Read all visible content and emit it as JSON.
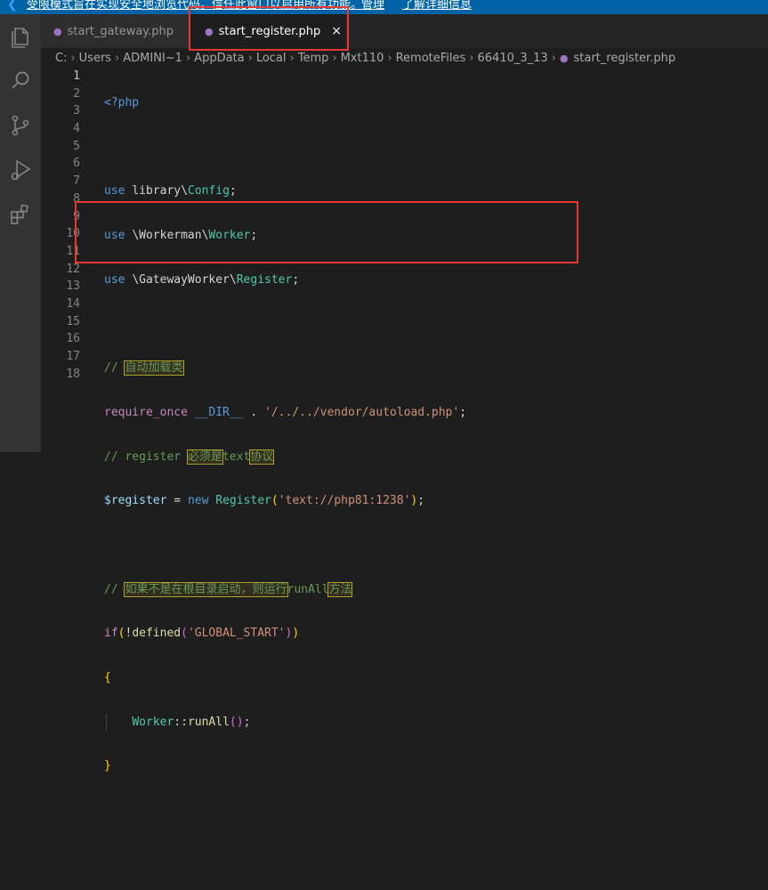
{
  "titlebar": {
    "notice": "受限模式旨在实现安全地浏览代码。信任此窗口以启用所有功能。",
    "action_manage": "管理",
    "action_learn": "了解详细信息"
  },
  "tabs": [
    {
      "label": "start_gateway.php",
      "active": false
    },
    {
      "label": "start_register.php",
      "active": true
    }
  ],
  "tab_close_glyph": "×",
  "breadcrumb": [
    "C:",
    "Users",
    "ADMINI~1",
    "AppData",
    "Local",
    "Temp",
    "Mxt110",
    "RemoteFiles",
    "66410_3_13",
    "start_register.php"
  ],
  "breadcrumb_sep": "›",
  "line_numbers": [
    "1",
    "2",
    "3",
    "4",
    "5",
    "6",
    "7",
    "8",
    "9",
    "10",
    "11",
    "12",
    "13",
    "14",
    "15",
    "16",
    "17",
    "18"
  ],
  "code": {
    "l1_tag": "<?php",
    "l3_use": "use",
    "l3_ns": "library",
    "l3_sep": "\\",
    "l3_cls": "Config",
    "l3_end": ";",
    "l4_use": "use",
    "l4_sep1": "\\",
    "l4_ns": "Workerman",
    "l4_sep2": "\\",
    "l4_cls": "Worker",
    "l4_end": ";",
    "l5_use": "use",
    "l5_sep1": "\\",
    "l5_ns": "GatewayWorker",
    "l5_sep2": "\\",
    "l5_cls": "Register",
    "l5_end": ";",
    "l7_slash": "// ",
    "l7_text": "自动加载类",
    "l8_kw": "require_once",
    "l8_sp": " ",
    "l8_const": "__DIR__",
    "l8_dot": " . ",
    "l8_str": "'/../../vendor/autoload.php'",
    "l8_end": ";",
    "l9_slash": "// register ",
    "l9_hl1": "必须是",
    "l9_mid": "text",
    "l9_hl2": "协议",
    "l10_var": "$register",
    "l10_eq": " = ",
    "l10_new": "new",
    "l10_sp": " ",
    "l10_cls": "Register",
    "l10_po": "(",
    "l10_str": "'text://php81:1238'",
    "l10_pc": ")",
    "l10_end": ";",
    "l12_slash": "// ",
    "l12_hl1": "如果不是在根目录启动，则运行",
    "l12_mid": "runAll",
    "l12_hl2": "方法",
    "l13_if": "if",
    "l13_po": "(",
    "l13_not": "!",
    "l13_fn": "defined",
    "l13_po2": "(",
    "l13_str": "'GLOBAL_START'",
    "l13_pc2": ")",
    "l13_pc": ")",
    "l14_brace": "{",
    "l15_cls": "Worker",
    "l15_op": "::",
    "l15_fn": "runAll",
    "l15_paren": "()",
    "l15_end": ";",
    "l16_brace": "}"
  },
  "colors": {
    "highlight_box": "#e53935",
    "accent_titlebar": "#0063a6",
    "php_icon": "#a074c4"
  }
}
